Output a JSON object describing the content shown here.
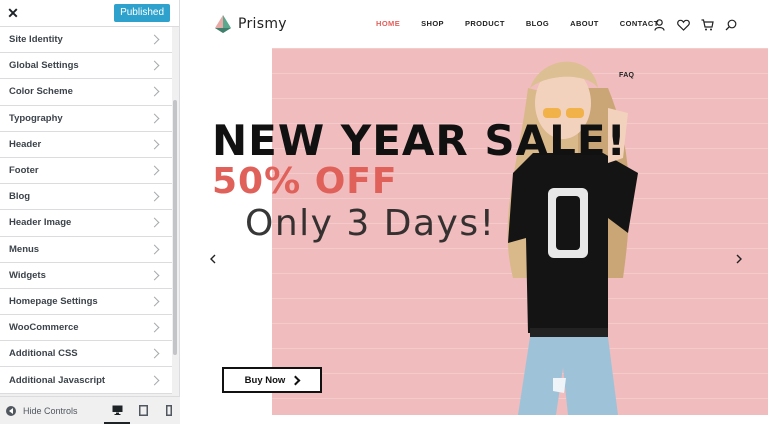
{
  "sidebar": {
    "close_icon": "close-icon",
    "publish_label": "Published",
    "items": [
      {
        "label": "Site Identity"
      },
      {
        "label": "Global Settings"
      },
      {
        "label": "Color Scheme"
      },
      {
        "label": "Typography"
      },
      {
        "label": "Header"
      },
      {
        "label": "Footer"
      },
      {
        "label": "Blog"
      },
      {
        "label": "Header Image"
      },
      {
        "label": "Menus"
      },
      {
        "label": "Widgets"
      },
      {
        "label": "Homepage Settings"
      },
      {
        "label": "WooCommerce"
      },
      {
        "label": "Additional CSS"
      },
      {
        "label": "Additional Javascript"
      }
    ],
    "hide_controls_label": "Hide Controls",
    "devices": [
      "desktop-icon",
      "tablet-icon",
      "mobile-icon"
    ]
  },
  "site": {
    "logo_text": "Prismy",
    "nav": [
      {
        "label": "HOME",
        "active": true
      },
      {
        "label": "SHOP",
        "active": false
      },
      {
        "label": "PRODUCT",
        "active": false
      },
      {
        "label": "BLOG",
        "active": false
      },
      {
        "label": "ABOUT",
        "active": false
      },
      {
        "label": "CONTACT",
        "active": false
      }
    ],
    "header_icons": [
      "user-icon",
      "heart-icon",
      "cart-icon",
      "search-icon"
    ],
    "faq_label": "FAQ"
  },
  "hero": {
    "headline": "NEW YEAR SALE!",
    "offer": "50% OFF",
    "subtext": "Only 3 Days!",
    "button_label": "Buy Now",
    "colors": {
      "background": "#f0bcbd",
      "accent": "#e0605a"
    }
  }
}
